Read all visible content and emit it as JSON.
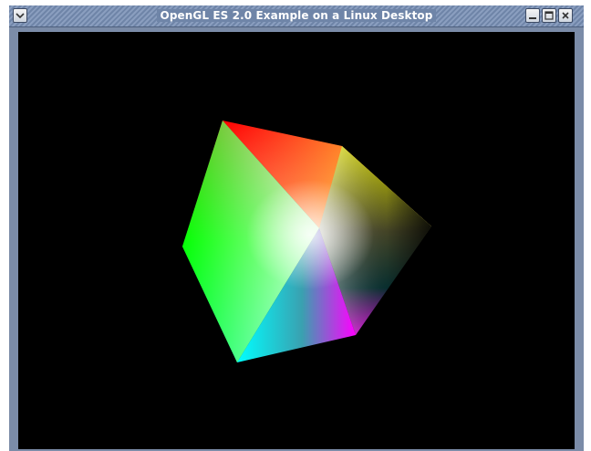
{
  "window": {
    "title": "OpenGL ES 2.0 Example on a Linux Desktop",
    "buttons": {
      "menu": "window-menu-icon",
      "minimize": "minimize-icon",
      "maximize": "maximize-icon",
      "close": "close-icon"
    }
  },
  "scene": {
    "background": "#000000",
    "object": "rgb-color-cube"
  },
  "colors": {
    "titlebar": "#7b8ca8",
    "frame": "#7b8ca8"
  }
}
